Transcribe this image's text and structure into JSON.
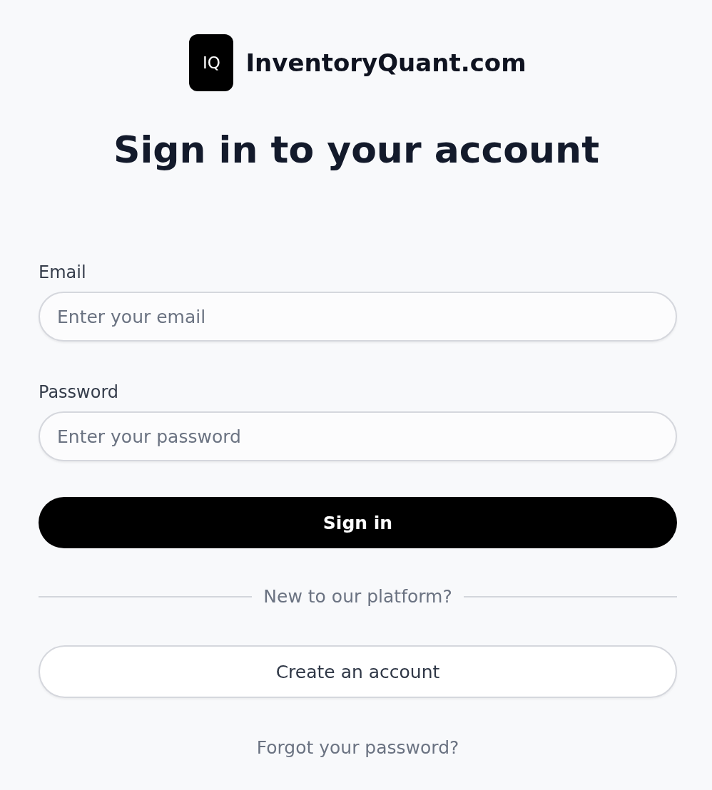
{
  "logo": {
    "mark": "IQ",
    "name": "InventoryQuant.com"
  },
  "title": "Sign in to your account",
  "fields": [
    {
      "label": "Email",
      "placeholder": "Enter your email"
    },
    {
      "label": "Password",
      "placeholder": "Enter your password"
    }
  ],
  "sign_in_button": "Sign in",
  "divider_text": "New to our platform?",
  "create_account_button": "Create an account",
  "forgot_password_link": "Forgot your password?"
}
